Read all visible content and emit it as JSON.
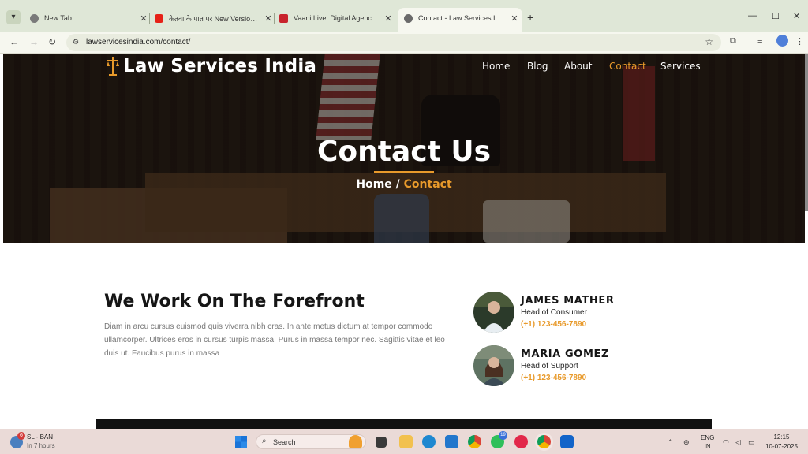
{
  "browser": {
    "tabs": [
      {
        "title": "New Tab",
        "favicon_color": "#7a7a7a"
      },
      {
        "title": "केतवा के पात पर New Version, Ka",
        "favicon_color": "#e62117"
      },
      {
        "title": "Vaani Live: Digital Agency, Web",
        "favicon_color": "#c8232c"
      },
      {
        "title": "Contact - Law Services India",
        "favicon_color": "#6a6a6a"
      }
    ],
    "url": "lawservicesindia.com/contact/"
  },
  "site": {
    "logo_text": "Law Services India",
    "nav": [
      "Home",
      "Blog",
      "About",
      "Contact",
      "Services"
    ],
    "hero_title": "Contact Us",
    "breadcrumb_home": "Home /",
    "breadcrumb_current": "Contact",
    "section_title": "We Work On The Forefront",
    "section_text": "Diam in arcu cursus euismod quis viverra nibh cras. In ante metus dictum at tempor commodo ullamcorper. Ultrices eros in cursus turpis massa. Purus in massa tempor nec. Sagittis vitae et leo duis ut. Faucibus purus in massa",
    "accent_color": "#e89a2b",
    "people": [
      {
        "name": "JAMES MATHER",
        "role": "Head of Consumer",
        "phone": "(+1) 123-456-7890"
      },
      {
        "name": "MARIA GOMEZ",
        "role": "Head of Support",
        "phone": "(+1) 123-456-7890"
      }
    ]
  },
  "taskbar": {
    "weather_badge": "6",
    "weather_title": "SL - BAN",
    "weather_sub": "In 7 hours",
    "search_label": "Search",
    "whatsapp_badge": "19",
    "lang_top": "ENG",
    "lang_bottom": "IN",
    "time": "12:15",
    "date": "10-07-2025"
  }
}
